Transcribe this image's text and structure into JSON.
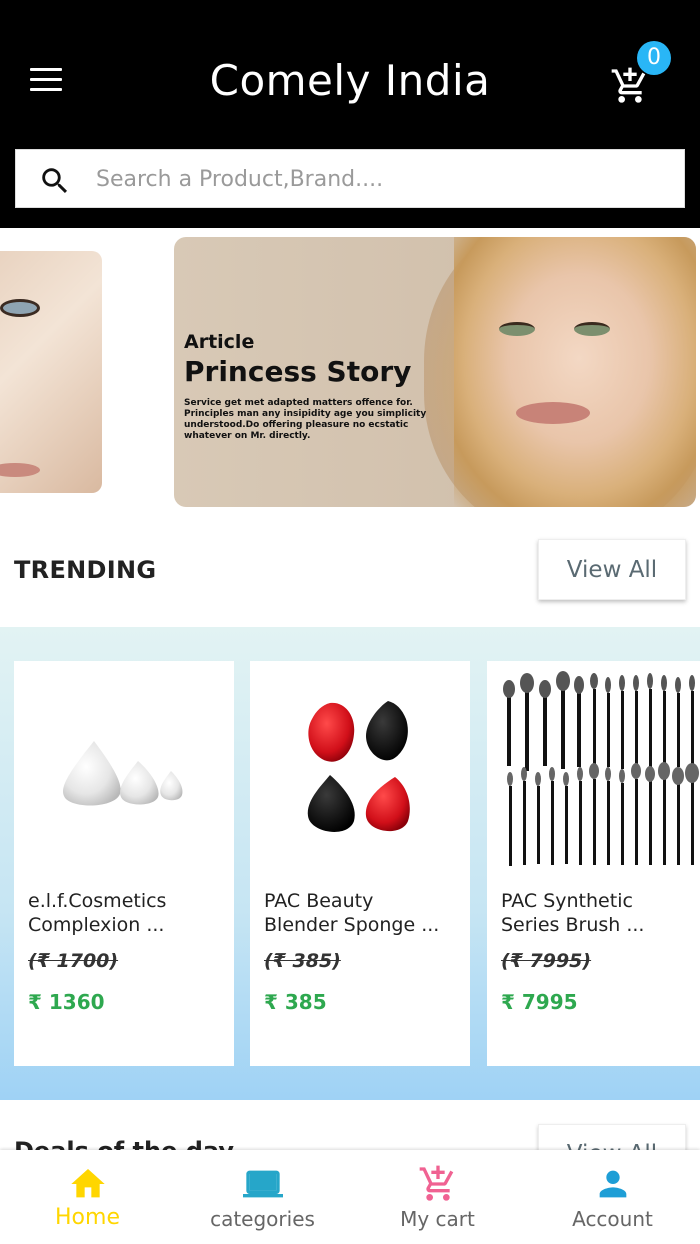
{
  "header": {
    "title": "Comely India",
    "cart_count": "0",
    "search_placeholder": "Search a Product,Brand...."
  },
  "banner": {
    "kicker": "Article",
    "title": "Princess Story",
    "text": "Service get met adapted matters offence for. Principles man any insipidity age you simplicity understood.Do offering pleasure no ecstatic whatever on Mr. directly."
  },
  "trending": {
    "title": "TRENDING",
    "view_all": "View All",
    "products": [
      {
        "name_line1": "e.l.f.Cosmetics",
        "name_line2": "Complexion ...",
        "mrp": "(₹ 1700)",
        "price": "₹ 1360",
        "image": "sponge-set-icon"
      },
      {
        "name_line1": "PAC Beauty",
        "name_line2": "Blender Sponge ...",
        "mrp": "(₹ 385)",
        "price": "₹ 385",
        "image": "blender-sponges-icon"
      },
      {
        "name_line1": "PAC Synthetic",
        "name_line2": "Series Brush ...",
        "mrp": "(₹ 7995)",
        "price": "₹ 7995",
        "image": "brush-set-icon"
      }
    ]
  },
  "next_section": {
    "title": "Deals of the day",
    "view_all": "View All"
  },
  "bottom_nav": {
    "items": [
      {
        "label": "Home",
        "icon": "home-icon",
        "active": true
      },
      {
        "label": "categories",
        "icon": "categories-icon",
        "active": false
      },
      {
        "label": "My cart",
        "icon": "cart-icon",
        "active": false
      },
      {
        "label": "Account",
        "icon": "account-icon",
        "active": false
      }
    ]
  },
  "colors": {
    "header_bg": "#000000",
    "badge": "#29b6f6",
    "price_green": "#2ea84f",
    "home_active": "#ffd600",
    "categories_icon": "#26a6c9",
    "cart_icon": "#f06292",
    "account_icon": "#1e9ed6"
  }
}
